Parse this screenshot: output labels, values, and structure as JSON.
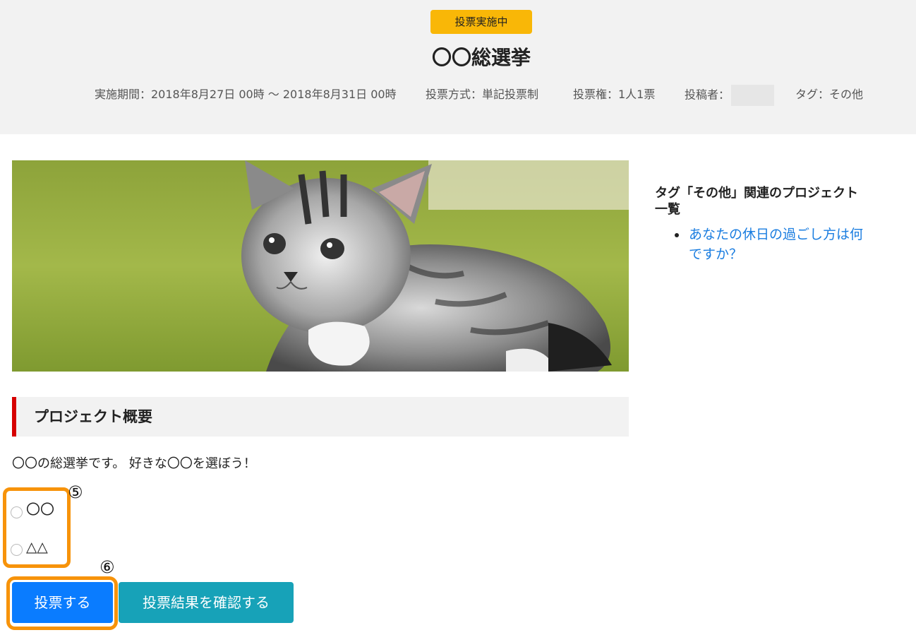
{
  "header": {
    "status_badge": "投票実施中",
    "title": "〇〇総選挙",
    "meta": {
      "period": "実施期間：2018年8月27日 00時 〜 2018年8月31日 00時",
      "method": "投票方式：単記投票制",
      "voting_right": "投票権：1人1票",
      "author_label": "投稿者：",
      "tag": "タグ：その他"
    }
  },
  "hero_image": {
    "description_icon": "kitten-photo"
  },
  "project": {
    "heading": "プロジェクト概要",
    "description": "〇〇の総選挙です。 好きな〇〇を選ぼう！",
    "options": [
      {
        "label": "〇〇",
        "selected": false
      },
      {
        "label": "△△",
        "selected": false
      }
    ]
  },
  "annotations": {
    "options_callout": "⑤",
    "vote_callout": "⑥",
    "highlight_color": "#f7930a"
  },
  "actions": {
    "vote_label": "投票する",
    "results_label": "投票結果を確認する"
  },
  "sidebar": {
    "title": "タグ「その他」関連のプロジェクト一覧",
    "items": [
      {
        "label": "あなたの休日の過ごし方は何ですか？"
      }
    ]
  },
  "colors": {
    "badge": "#f9b707",
    "vote_button": "#0a7cff",
    "results_button": "#17a2b8",
    "heading_accent": "#d60000",
    "link": "#1a7de0"
  }
}
